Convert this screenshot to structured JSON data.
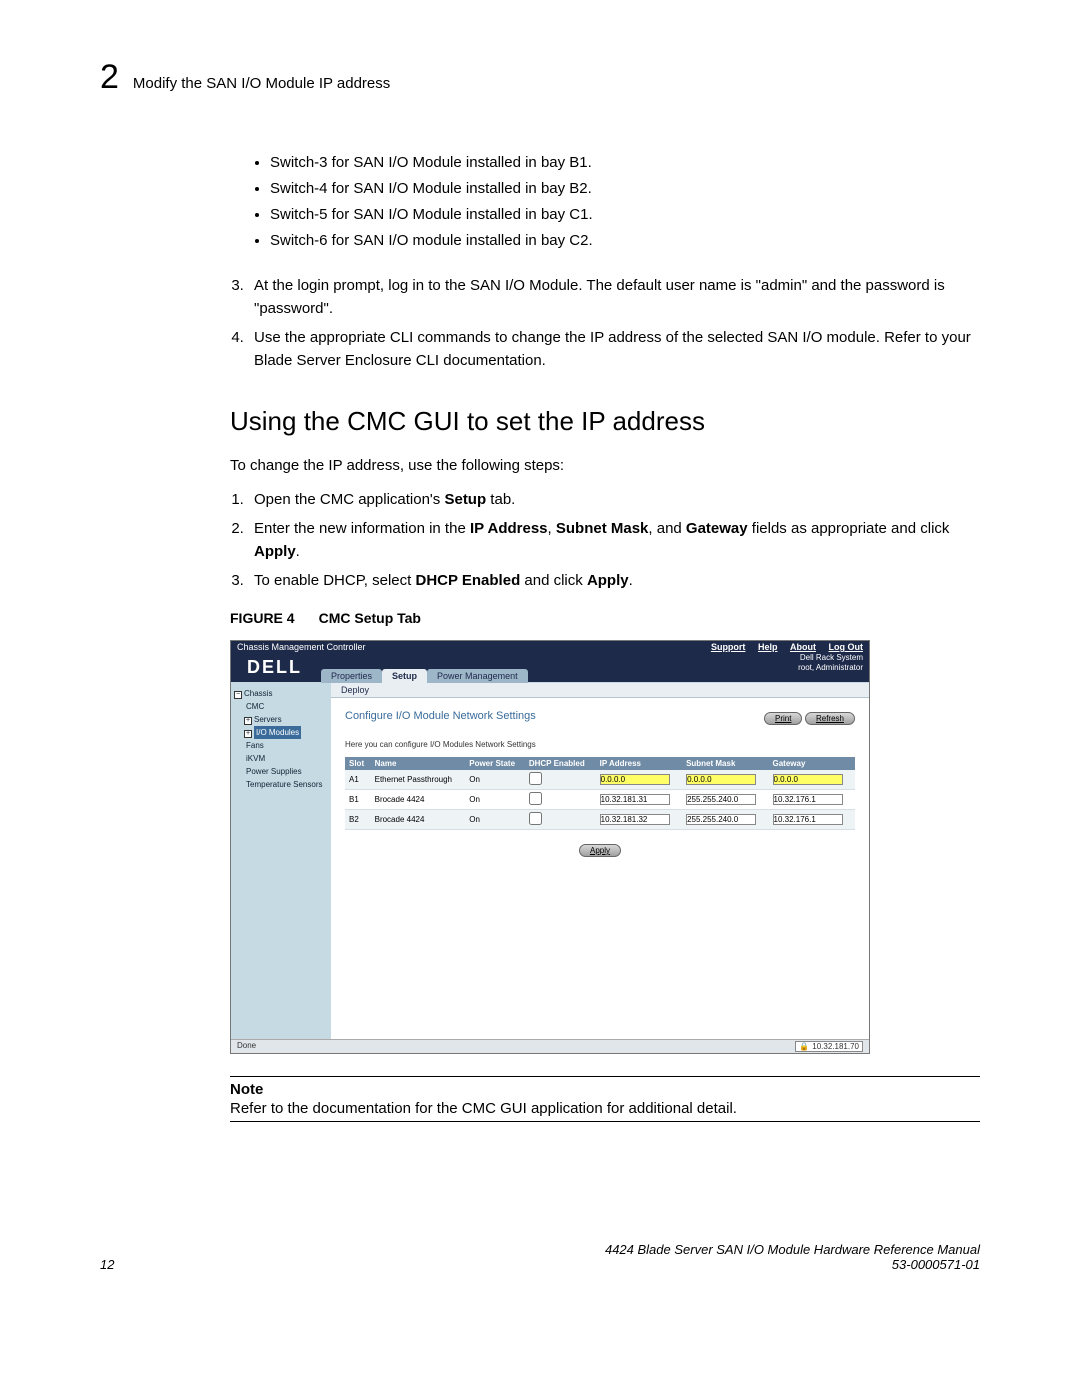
{
  "header": {
    "chapter": "2",
    "title": "Modify the SAN I/O Module IP address"
  },
  "switches": [
    "Switch-3 for SAN I/O Module installed in bay B1.",
    "Switch-4 for SAN I/O Module installed in bay B2.",
    "Switch-5 for SAN I/O Module installed in bay C1.",
    "Switch-6 for SAN I/O module installed in bay C2."
  ],
  "steps_top": {
    "s3": "At the login prompt, log in to the SAN I/O Module. The default user name is \"admin\" and the password is \"password\".",
    "s4": "Use the appropriate CLI commands to change the IP address of the selected SAN I/O module. Refer to your Blade Server Enclosure CLI documentation."
  },
  "section_heading": "Using the CMC GUI to set the IP address",
  "intro": "To change the IP address, use the following steps:",
  "steps_gui": {
    "s1_a": "Open the CMC application's ",
    "s1_b": "Setup",
    "s1_c": " tab.",
    "s2_a": "Enter the new information in the ",
    "s2_b": "IP Address",
    "s2_c": ", ",
    "s2_d": "Subnet Mask",
    "s2_e": ", and ",
    "s2_f": "Gateway",
    "s2_g": " fields as appropriate and click ",
    "s2_h": "Apply",
    "s2_i": ".",
    "s3_a": "To enable DHCP, select ",
    "s3_b": "DHCP Enabled",
    "s3_c": " and click ",
    "s3_d": "Apply",
    "s3_e": "."
  },
  "figure": {
    "label": "FIGURE 4",
    "caption": "CMC Setup Tab"
  },
  "cmc": {
    "title": "Chassis Management Controller",
    "topnav": [
      "Support",
      "Help",
      "About",
      "Log Out"
    ],
    "sysinfo": [
      "Dell Rack System",
      "root, Administrator"
    ],
    "logo": "DELL",
    "tabs": [
      "Properties",
      "Setup",
      "Power Management"
    ],
    "active_tab": "Setup",
    "subtab": "Deploy",
    "tree": {
      "l0": "Chassis",
      "l1": "CMC",
      "l2": "Servers",
      "l3": "I/O Modules",
      "l4": "Fans",
      "l5": "iKVM",
      "l6": "Power Supplies",
      "l7": "Temperature Sensors",
      "box_minus": "−",
      "box_plus": "+"
    },
    "content": {
      "heading": "Configure I/O Module Network Settings",
      "btn_print": "Print",
      "btn_refresh": "Refresh",
      "note": "Here you can configure I/O Modules Network Settings",
      "columns": [
        "Slot",
        "Name",
        "Power State",
        "DHCP Enabled",
        "IP Address",
        "Subnet Mask",
        "Gateway"
      ],
      "rows": [
        {
          "slot": "A1",
          "name": "Ethernet Passthrough",
          "power": "On",
          "dhcp": false,
          "ip": "0.0.0.0",
          "mask": "0.0.0.0",
          "gw": "0.0.0.0",
          "hl": true
        },
        {
          "slot": "B1",
          "name": "Brocade 4424",
          "power": "On",
          "dhcp": false,
          "ip": "10.32.181.31",
          "mask": "255.255.240.0",
          "gw": "10.32.176.1",
          "hl": false
        },
        {
          "slot": "B2",
          "name": "Brocade 4424",
          "power": "On",
          "dhcp": false,
          "ip": "10.32.181.32",
          "mask": "255.255.240.0",
          "gw": "10.32.176.1",
          "hl": false
        }
      ],
      "apply": "Apply"
    },
    "status": {
      "left": "Done",
      "right": "10.32.181.70"
    }
  },
  "note": {
    "title": "Note",
    "text": "Refer to the documentation for the CMC GUI application for additional detail."
  },
  "footer": {
    "page": "12",
    "manual": "4424 Blade Server SAN I/O Module Hardware Reference Manual",
    "docnum": "53-0000571-01"
  }
}
